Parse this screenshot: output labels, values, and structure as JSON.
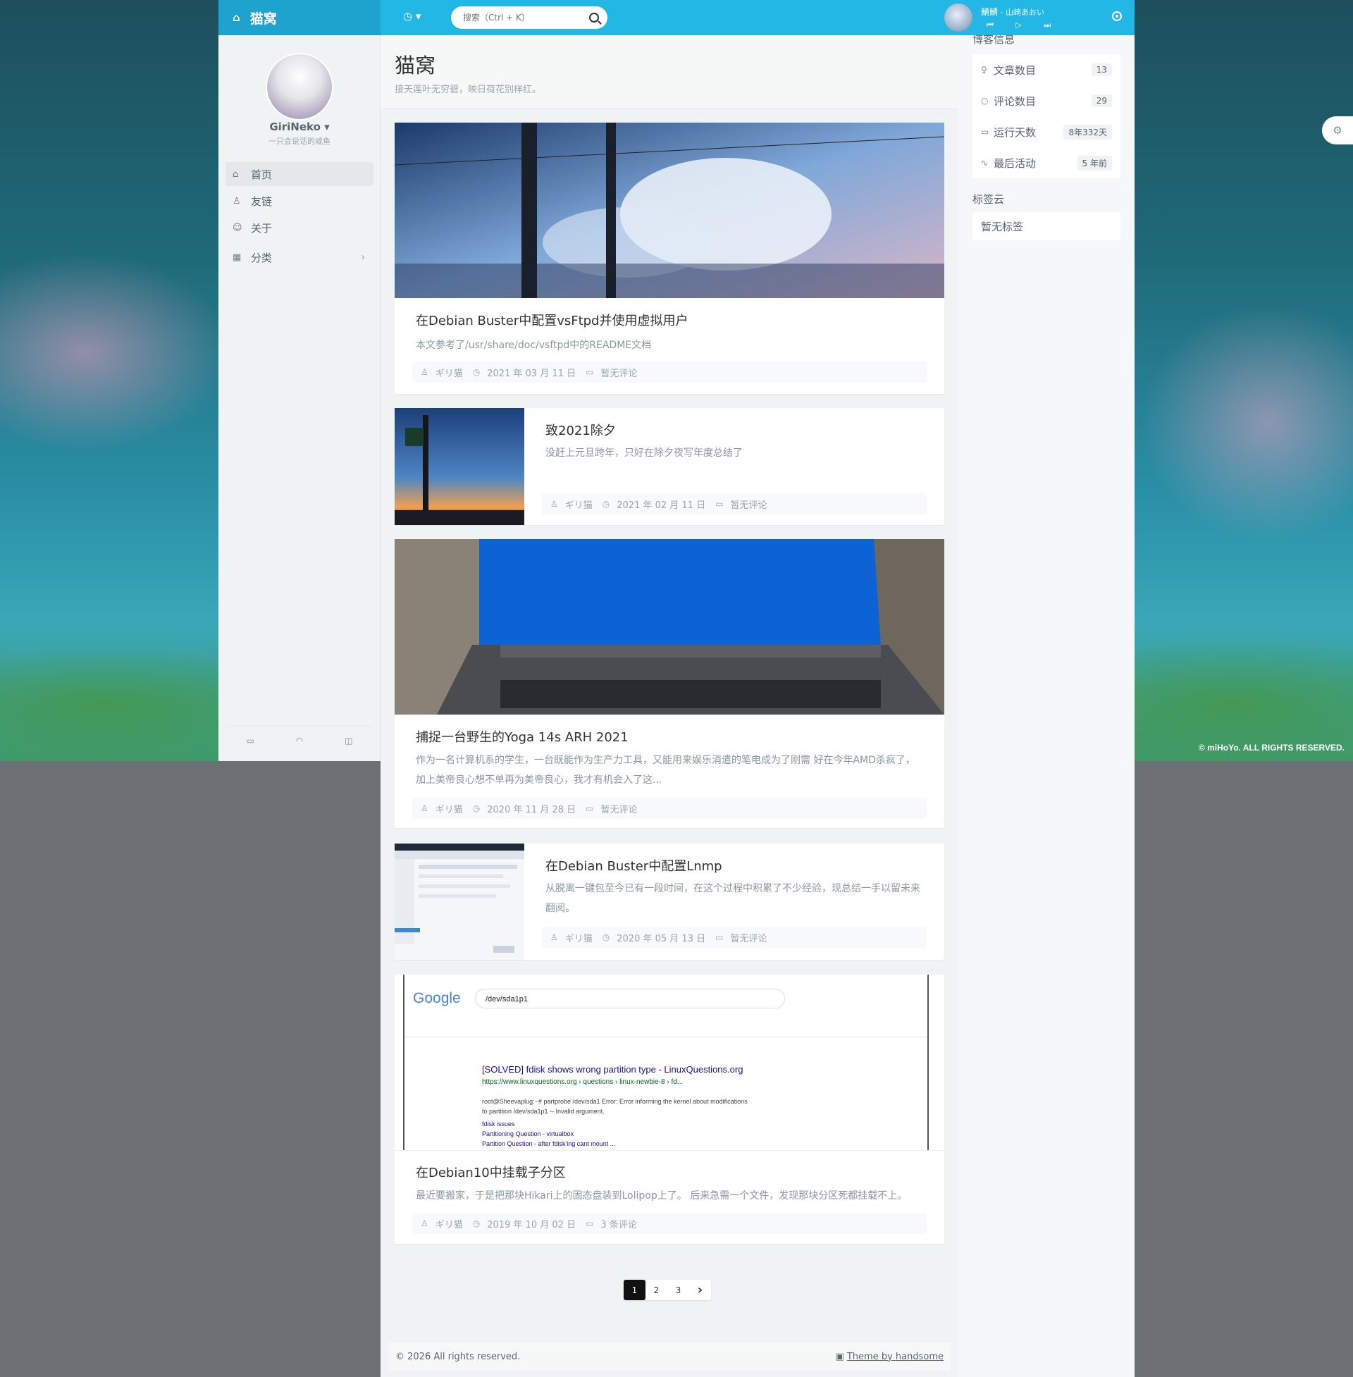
{
  "brand": {
    "title": "猫窝",
    "icon": "home-icon"
  },
  "search": {
    "placeholder": "搜索（Ctrl + K）"
  },
  "player": {
    "song": "鯖鯖",
    "artist": " - 山崎あおい",
    "controls": "⏮ ▷ ⏭"
  },
  "copyright_mihoyo": "© miHoYo. ALL RIGHTS RESERVED.",
  "profile": {
    "name": "GiriNeko ▾",
    "tagline": "一只会说话的咸鱼"
  },
  "nav": [
    {
      "label": "首页",
      "icon": "home-icon",
      "active": true
    },
    {
      "label": "友链",
      "icon": "user-icon"
    },
    {
      "label": "关于",
      "icon": "smile-icon"
    },
    {
      "label": "分类",
      "icon": "grid-icon",
      "arrow": "›"
    }
  ],
  "page": {
    "title": "猫窝",
    "subtitle": "接天莲叶无穷碧，映日荷花别样红。"
  },
  "posts": [
    {
      "title": "在Debian Buster中配置vsFtpd并使用虚拟用户",
      "summary": "本文参考了/usr/share/doc/vsftpd中的README文档",
      "author": "ギリ猫",
      "date": "2021 年 03 月 11 日",
      "comments": "暂无评论",
      "layout": "large"
    },
    {
      "title": "致2021除夕",
      "summary": "没赶上元旦跨年，只好在除夕夜写年度总结了",
      "author": "ギリ猫",
      "date": "2021 年 02 月 11 日",
      "comments": "暂无评论",
      "layout": "small"
    },
    {
      "title": "捕捉一台野生的Yoga 14s ARH 2021",
      "summary": "作为一名计算机系的学生，一台既能作为生产力工具，又能用来娱乐消遣的笔电成为了刚需 好在今年AMD杀疯了，加上美帝良心想不单再为美帝良心，我才有机会入了这...",
      "author": "ギリ猫",
      "date": "2020 年 11 月 28 日",
      "comments": "暂无评论",
      "layout": "large"
    },
    {
      "title": "在Debian Buster中配置Lnmp",
      "summary": "从脱离一键包至今已有一段时间，在这个过程中积累了不少经验，现总结一手以留未来翻阅。",
      "author": "ギリ猫",
      "date": "2020 年 05 月 13 日",
      "comments": "暂无评论",
      "layout": "small"
    },
    {
      "title": "在Debian10中挂载子分区",
      "summary": "最近要搬家，于是把那块Hikari上的固态盘装到Lolipop上了。 后来急需一个文件，发现那块分区死都挂载不上。",
      "author": "ギリ猫",
      "date": "2019 年 10 月 02 日",
      "comments": "3 条评论",
      "layout": "large"
    }
  ],
  "google_shot": {
    "logo": "Google",
    "query": "/dev/sda1p1",
    "result_title": "[SOLVED] fdisk shows wrong partition type - LinuxQuestions.org",
    "result_url": "https://www.linuxquestions.org › questions › linux-newbie-8 › fd...",
    "snippet1": "root@Sheevaplug:~# partprobe /dev/sda1 Error: Error informing the kernel about modifications",
    "snippet2": "to partition /dev/sda1p1 -- Invalid argument.",
    "sub1": "fdisk issues",
    "sub2": "Partitioning Question - virtualbox",
    "sub3": "Partition Question - after fdisk'ing cant mount ..."
  },
  "pagination": {
    "pages": [
      "1",
      "2",
      "3"
    ],
    "next": "›",
    "current": "1"
  },
  "footer": {
    "copyright": "© 2026 All rights reserved.",
    "theme": "Theme by handsome"
  },
  "blog_info": {
    "title": "博客信息",
    "rows": [
      {
        "label": "文章数目",
        "value": "13",
        "icon": "pin-icon"
      },
      {
        "label": "评论数目",
        "value": "29",
        "icon": "comment-icon"
      },
      {
        "label": "运行天数",
        "value": "8年332天",
        "icon": "calendar-icon"
      },
      {
        "label": "最后活动",
        "value": "5 年前",
        "icon": "activity-icon"
      }
    ]
  },
  "tag_cloud": {
    "title": "标签云",
    "empty": "暂无标签"
  },
  "colors": {
    "accent": "#23b7e5",
    "brand_bg": "#1ea3cf",
    "sidebar_bg": "#f0f3f4"
  }
}
